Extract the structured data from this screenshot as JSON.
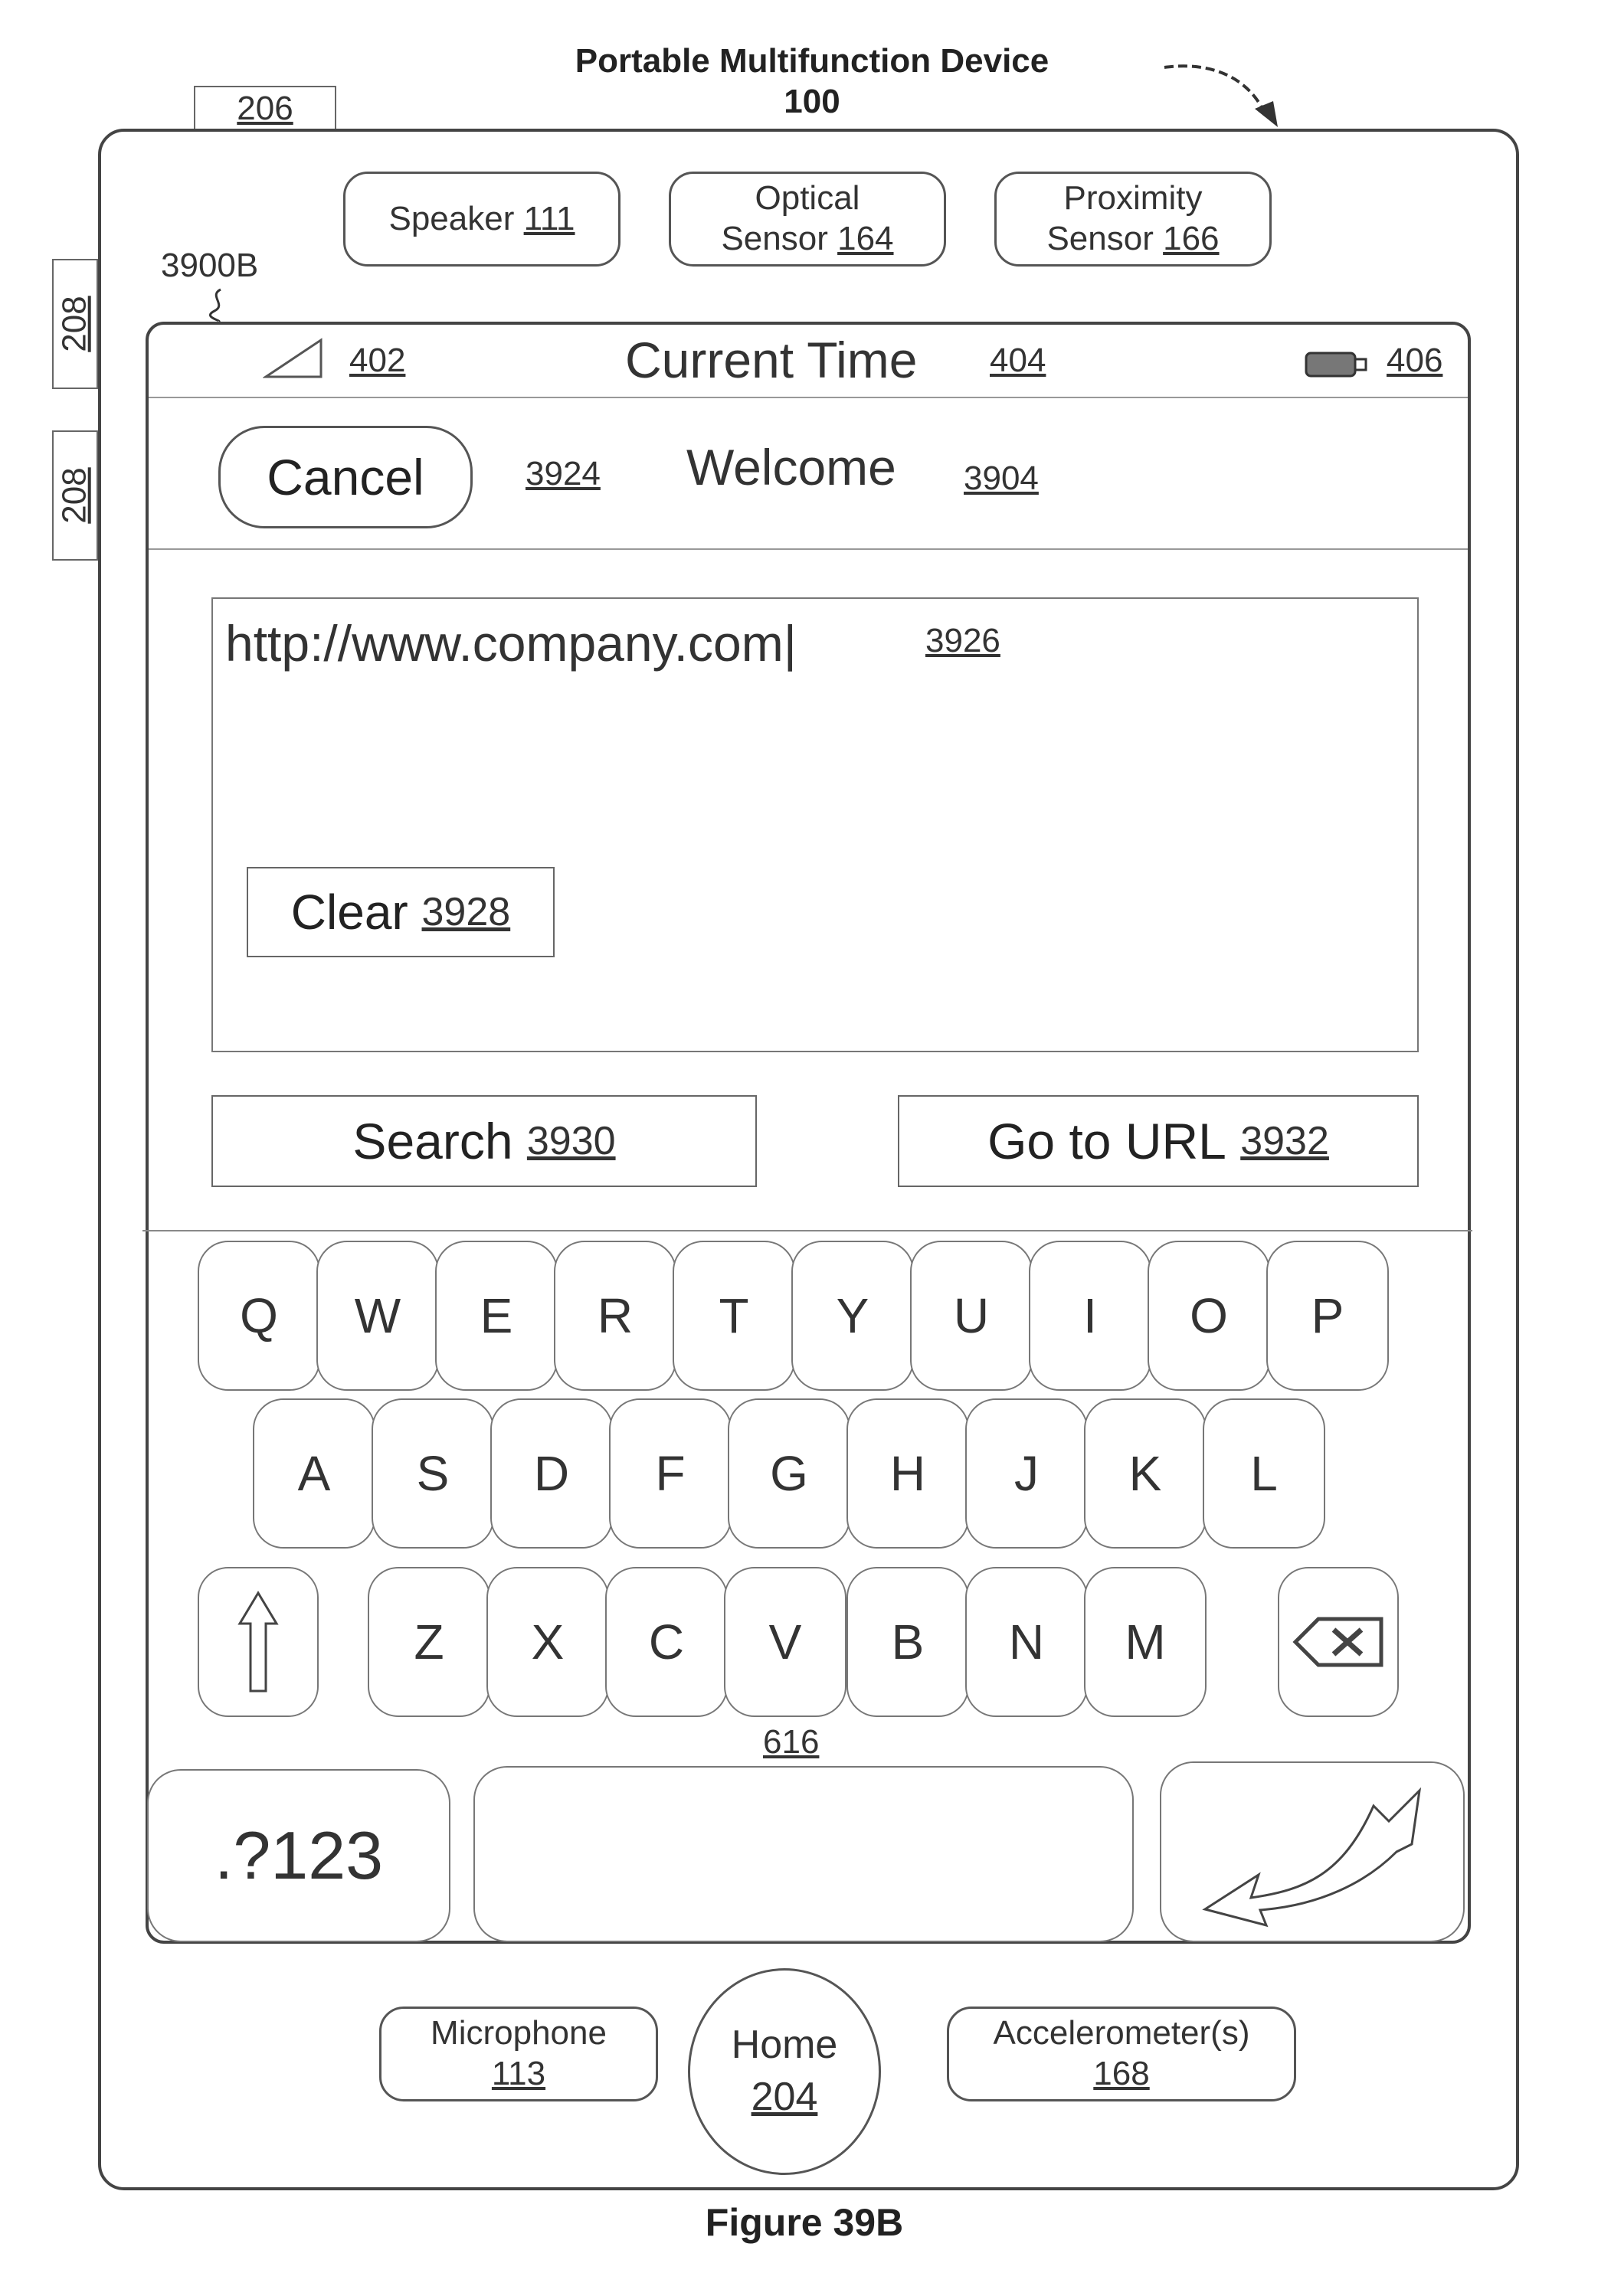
{
  "header": {
    "title": "Portable Multifunction Device",
    "number": "100",
    "ref_206": "206",
    "ref_208": "208",
    "ref_3900": "3900B"
  },
  "hardware_top": {
    "speaker": {
      "label": "Speaker",
      "ref": "111"
    },
    "optical": {
      "label1": "Optical",
      "label2": "Sensor",
      "ref": "164"
    },
    "proximity": {
      "label1": "Proximity",
      "label2": "Sensor",
      "ref": "166"
    }
  },
  "status_bar": {
    "signal_ref": "402",
    "time": "Current Time",
    "time_ref": "404",
    "battery_ref": "406"
  },
  "nav": {
    "cancel": "Cancel",
    "cancel_ref": "3924",
    "welcome": "Welcome",
    "welcome_ref": "3904"
  },
  "url_field": {
    "value": "http://www.company.com|",
    "ref": "3926",
    "clear": "Clear",
    "clear_ref": "3928"
  },
  "actions": {
    "search": "Search",
    "search_ref": "3930",
    "go": "Go to URL",
    "go_ref": "3932"
  },
  "keyboard": {
    "row1": [
      "Q",
      "W",
      "E",
      "R",
      "T",
      "Y",
      "U",
      "I",
      "O",
      "P"
    ],
    "row2": [
      "A",
      "S",
      "D",
      "F",
      "G",
      "H",
      "J",
      "K",
      "L"
    ],
    "row3": [
      "Z",
      "X",
      "C",
      "V",
      "B",
      "N",
      "M"
    ],
    "ref": "616",
    "numbers": ".?123"
  },
  "hardware_bottom": {
    "microphone": {
      "label": "Microphone",
      "ref": "113"
    },
    "home": {
      "label": "Home",
      "ref": "204"
    },
    "accelerometer": {
      "label": "Accelerometer(s)",
      "ref": "168"
    }
  },
  "caption": "Figure 39B"
}
